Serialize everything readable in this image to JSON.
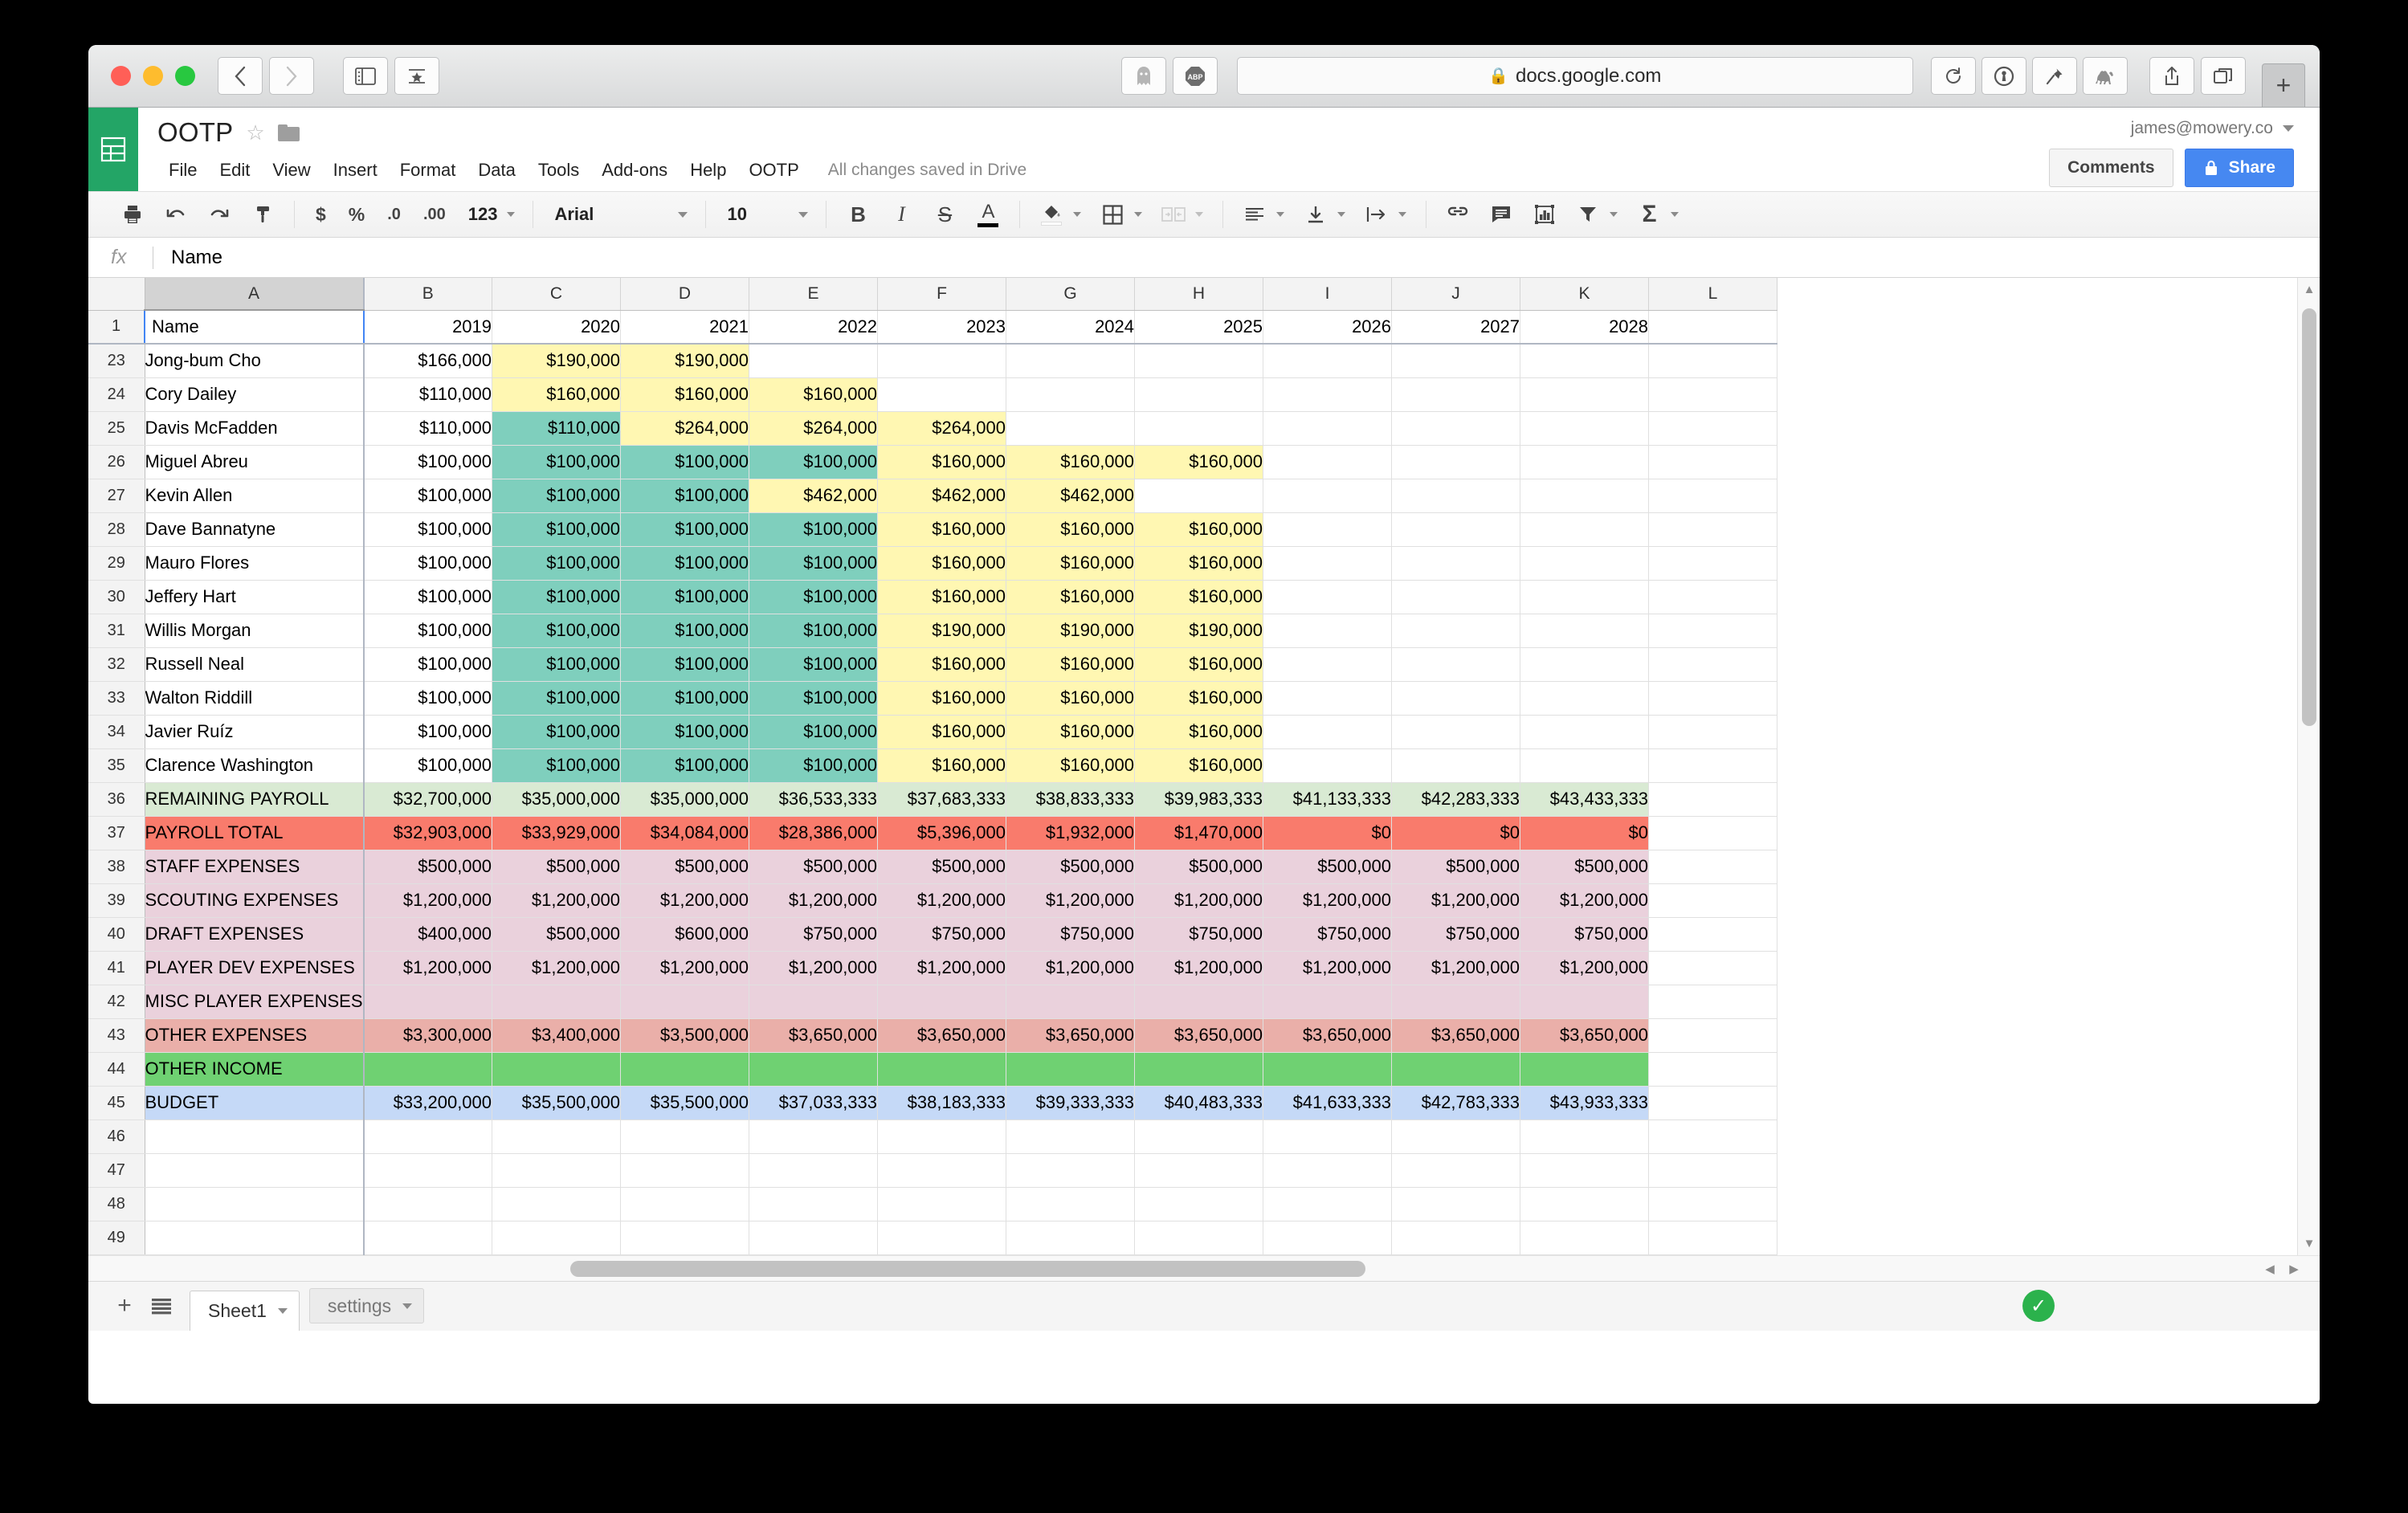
{
  "browser": {
    "url": "docs.google.com",
    "lock_icon": "lock-icon",
    "back_icon": "back-chevron-icon",
    "forward_icon": "forward-chevron-icon",
    "sidebar_icon": "sidebar-icon",
    "reader_icon": "reading-list-star-icon",
    "ghostery_icon": "ghostery-ghost-icon",
    "adblock_label": "ABP",
    "reload_icon": "reload-icon",
    "onepassword_icon": "1password-icon",
    "pinboard_icon": "pushpin-icon",
    "camel_icon": "camel-icon",
    "share_icon": "share-icon",
    "tabs_icon": "tab-overview-icon",
    "newtab_label": "+"
  },
  "app": {
    "logo_icon": "google-sheets-icon",
    "title": "OOTP",
    "star_icon": "star-outline-icon",
    "folder_icon": "folder-icon",
    "menus": [
      "File",
      "Edit",
      "View",
      "Insert",
      "Format",
      "Data",
      "Tools",
      "Add-ons",
      "Help",
      "OOTP"
    ],
    "save_status": "All changes saved in Drive",
    "account_email": "james@mowery.co",
    "comments_label": "Comments",
    "share_label": "Share",
    "share_lock_icon": "lock-icon"
  },
  "toolbar": {
    "print_icon": "print-icon",
    "undo_icon": "undo-icon",
    "redo_icon": "redo-icon",
    "paint_icon": "paint-format-icon",
    "currency_label": "$",
    "percent_label": "%",
    "dec_decrease_label": ".0",
    "dec_increase_label": ".00",
    "number_format_label": "123",
    "font_family": "Arial",
    "font_size": "10",
    "bold_label": "B",
    "italic_label": "I",
    "strikethrough_label": "S",
    "text_color_label": "A",
    "fill_icon": "fill-color-icon",
    "borders_icon": "borders-icon",
    "merge_icon": "merge-cells-icon",
    "align_icon": "horizontal-align-icon",
    "valign_icon": "vertical-align-icon",
    "wrap_icon": "text-wrap-icon",
    "link_icon": "insert-link-icon",
    "comment_icon": "insert-comment-icon",
    "chart_icon": "insert-chart-icon",
    "filter_icon": "filter-icon",
    "functions_icon": "sum-sigma-icon"
  },
  "formula_bar": {
    "fx_label": "fx",
    "value": "Name"
  },
  "grid": {
    "selected_cell": "A1",
    "columns": [
      "A",
      "B",
      "C",
      "D",
      "E",
      "F",
      "G",
      "H",
      "I",
      "J",
      "K",
      "L"
    ],
    "header_row_number": "1",
    "header_values": [
      "Name",
      "2019",
      "2020",
      "2021",
      "2022",
      "2023",
      "2024",
      "2025",
      "2026",
      "2027",
      "2028",
      ""
    ],
    "rows": [
      {
        "n": "23",
        "name": "Jong-bum Cho",
        "style": "player",
        "vals": [
          "$166,000",
          "$190,000",
          "$190,000",
          "",
          "",
          "",
          "",
          "",
          "",
          ""
        ],
        "fills": [
          "w",
          "y",
          "y",
          "w",
          "w",
          "w",
          "w",
          "w",
          "w",
          "w"
        ]
      },
      {
        "n": "24",
        "name": "Cory Dailey",
        "style": "player",
        "vals": [
          "$110,000",
          "$160,000",
          "$160,000",
          "$160,000",
          "",
          "",
          "",
          "",
          "",
          ""
        ],
        "fills": [
          "w",
          "y",
          "y",
          "y",
          "w",
          "w",
          "w",
          "w",
          "w",
          "w"
        ]
      },
      {
        "n": "25",
        "name": "Davis McFadden",
        "style": "player",
        "vals": [
          "$110,000",
          "$110,000",
          "$264,000",
          "$264,000",
          "$264,000",
          "",
          "",
          "",
          "",
          ""
        ],
        "fills": [
          "w",
          "t",
          "y",
          "y",
          "y",
          "w",
          "w",
          "w",
          "w",
          "w"
        ]
      },
      {
        "n": "26",
        "name": "Miguel Abreu",
        "style": "player",
        "vals": [
          "$100,000",
          "$100,000",
          "$100,000",
          "$100,000",
          "$160,000",
          "$160,000",
          "$160,000",
          "",
          "",
          ""
        ],
        "fills": [
          "w",
          "t",
          "t",
          "t",
          "y",
          "y",
          "y",
          "w",
          "w",
          "w"
        ]
      },
      {
        "n": "27",
        "name": "Kevin Allen",
        "style": "player",
        "vals": [
          "$100,000",
          "$100,000",
          "$100,000",
          "$462,000",
          "$462,000",
          "$462,000",
          "",
          "",
          "",
          ""
        ],
        "fills": [
          "w",
          "t",
          "t",
          "y",
          "y",
          "y",
          "w",
          "w",
          "w",
          "w"
        ]
      },
      {
        "n": "28",
        "name": "Dave Bannatyne",
        "style": "player",
        "vals": [
          "$100,000",
          "$100,000",
          "$100,000",
          "$100,000",
          "$160,000",
          "$160,000",
          "$160,000",
          "",
          "",
          ""
        ],
        "fills": [
          "w",
          "t",
          "t",
          "t",
          "y",
          "y",
          "y",
          "w",
          "w",
          "w"
        ]
      },
      {
        "n": "29",
        "name": "Mauro Flores",
        "style": "player",
        "vals": [
          "$100,000",
          "$100,000",
          "$100,000",
          "$100,000",
          "$160,000",
          "$160,000",
          "$160,000",
          "",
          "",
          ""
        ],
        "fills": [
          "w",
          "t",
          "t",
          "t",
          "y",
          "y",
          "y",
          "w",
          "w",
          "w"
        ]
      },
      {
        "n": "30",
        "name": "Jeffery Hart",
        "style": "player",
        "vals": [
          "$100,000",
          "$100,000",
          "$100,000",
          "$100,000",
          "$160,000",
          "$160,000",
          "$160,000",
          "",
          "",
          ""
        ],
        "fills": [
          "w",
          "t",
          "t",
          "t",
          "y",
          "y",
          "y",
          "w",
          "w",
          "w"
        ]
      },
      {
        "n": "31",
        "name": "Willis Morgan",
        "style": "player",
        "vals": [
          "$100,000",
          "$100,000",
          "$100,000",
          "$100,000",
          "$190,000",
          "$190,000",
          "$190,000",
          "",
          "",
          ""
        ],
        "fills": [
          "w",
          "t",
          "t",
          "t",
          "y",
          "y",
          "y",
          "w",
          "w",
          "w"
        ]
      },
      {
        "n": "32",
        "name": "Russell Neal",
        "style": "player",
        "vals": [
          "$100,000",
          "$100,000",
          "$100,000",
          "$100,000",
          "$160,000",
          "$160,000",
          "$160,000",
          "",
          "",
          ""
        ],
        "fills": [
          "w",
          "t",
          "t",
          "t",
          "y",
          "y",
          "y",
          "w",
          "w",
          "w"
        ]
      },
      {
        "n": "33",
        "name": "Walton Riddill",
        "style": "player",
        "vals": [
          "$100,000",
          "$100,000",
          "$100,000",
          "$100,000",
          "$160,000",
          "$160,000",
          "$160,000",
          "",
          "",
          ""
        ],
        "fills": [
          "w",
          "t",
          "t",
          "t",
          "y",
          "y",
          "y",
          "w",
          "w",
          "w"
        ]
      },
      {
        "n": "34",
        "name": "Javier Ruíz",
        "style": "player",
        "vals": [
          "$100,000",
          "$100,000",
          "$100,000",
          "$100,000",
          "$160,000",
          "$160,000",
          "$160,000",
          "",
          "",
          ""
        ],
        "fills": [
          "w",
          "t",
          "t",
          "t",
          "y",
          "y",
          "y",
          "w",
          "w",
          "w"
        ]
      },
      {
        "n": "35",
        "name": "Clarence Washington",
        "style": "player",
        "vals": [
          "$100,000",
          "$100,000",
          "$100,000",
          "$100,000",
          "$160,000",
          "$160,000",
          "$160,000",
          "",
          "",
          ""
        ],
        "fills": [
          "w",
          "t",
          "t",
          "t",
          "y",
          "y",
          "y",
          "w",
          "w",
          "w"
        ]
      },
      {
        "n": "36",
        "name": "REMAINING PAYROLL",
        "style": "lightgreen",
        "vals": [
          "$32,700,000",
          "$35,000,000",
          "$35,000,000",
          "$36,533,333",
          "$37,683,333",
          "$38,833,333",
          "$39,983,333",
          "$41,133,333",
          "$42,283,333",
          "$43,433,333"
        ],
        "fills": [
          "lg",
          "lg",
          "lg",
          "lg",
          "lg",
          "lg",
          "lg",
          "lg",
          "lg",
          "lg"
        ]
      },
      {
        "n": "37",
        "name": "PAYROLL TOTAL",
        "style": "red",
        "vals": [
          "$32,903,000",
          "$33,929,000",
          "$34,084,000",
          "$28,386,000",
          "$5,396,000",
          "$1,932,000",
          "$1,470,000",
          "$0",
          "$0",
          "$0"
        ],
        "fills": [
          "r",
          "r",
          "r",
          "r",
          "r",
          "r",
          "r",
          "r",
          "r",
          "r"
        ]
      },
      {
        "n": "38",
        "name": "STAFF EXPENSES",
        "style": "pink",
        "vals": [
          "$500,000",
          "$500,000",
          "$500,000",
          "$500,000",
          "$500,000",
          "$500,000",
          "$500,000",
          "$500,000",
          "$500,000",
          "$500,000"
        ],
        "fills": [
          "p",
          "p",
          "p",
          "p",
          "p",
          "p",
          "p",
          "p",
          "p",
          "p"
        ]
      },
      {
        "n": "39",
        "name": "SCOUTING EXPENSES",
        "style": "pink",
        "vals": [
          "$1,200,000",
          "$1,200,000",
          "$1,200,000",
          "$1,200,000",
          "$1,200,000",
          "$1,200,000",
          "$1,200,000",
          "$1,200,000",
          "$1,200,000",
          "$1,200,000"
        ],
        "fills": [
          "p",
          "p",
          "p",
          "p",
          "p",
          "p",
          "p",
          "p",
          "p",
          "p"
        ]
      },
      {
        "n": "40",
        "name": "DRAFT EXPENSES",
        "style": "pink",
        "vals": [
          "$400,000",
          "$500,000",
          "$600,000",
          "$750,000",
          "$750,000",
          "$750,000",
          "$750,000",
          "$750,000",
          "$750,000",
          "$750,000"
        ],
        "fills": [
          "p",
          "p",
          "p",
          "p",
          "p",
          "p",
          "p",
          "p",
          "p",
          "p"
        ]
      },
      {
        "n": "41",
        "name": "PLAYER DEV EXPENSES",
        "style": "pink",
        "vals": [
          "$1,200,000",
          "$1,200,000",
          "$1,200,000",
          "$1,200,000",
          "$1,200,000",
          "$1,200,000",
          "$1,200,000",
          "$1,200,000",
          "$1,200,000",
          "$1,200,000"
        ],
        "fills": [
          "p",
          "p",
          "p",
          "p",
          "p",
          "p",
          "p",
          "p",
          "p",
          "p"
        ]
      },
      {
        "n": "42",
        "name": "MISC PLAYER EXPENSES",
        "style": "pink",
        "vals": [
          "",
          "",
          "",
          "",
          "",
          "",
          "",
          "",
          "",
          ""
        ],
        "fills": [
          "p",
          "p",
          "p",
          "p",
          "p",
          "p",
          "p",
          "p",
          "p",
          "p"
        ]
      },
      {
        "n": "43",
        "name": "OTHER EXPENSES",
        "style": "darkpink",
        "vals": [
          "$3,300,000",
          "$3,400,000",
          "$3,500,000",
          "$3,650,000",
          "$3,650,000",
          "$3,650,000",
          "$3,650,000",
          "$3,650,000",
          "$3,650,000",
          "$3,650,000"
        ],
        "fills": [
          "dp",
          "dp",
          "dp",
          "dp",
          "dp",
          "dp",
          "dp",
          "dp",
          "dp",
          "dp"
        ]
      },
      {
        "n": "44",
        "name": "OTHER INCOME",
        "style": "green",
        "vals": [
          "",
          "",
          "",
          "",
          "",
          "",
          "",
          "",
          "",
          ""
        ],
        "fills": [
          "g",
          "g",
          "g",
          "g",
          "g",
          "g",
          "g",
          "g",
          "g",
          "g"
        ]
      },
      {
        "n": "45",
        "name": "BUDGET",
        "style": "blue",
        "vals": [
          "$33,200,000",
          "$35,500,000",
          "$35,500,000",
          "$37,033,333",
          "$38,183,333",
          "$39,333,333",
          "$40,483,333",
          "$41,633,333",
          "$42,783,333",
          "$43,933,333"
        ],
        "fills": [
          "b",
          "b",
          "b",
          "b",
          "b",
          "b",
          "b",
          "b",
          "b",
          "b"
        ]
      },
      {
        "n": "46",
        "name": "",
        "style": "empty",
        "vals": [
          "",
          "",
          "",
          "",
          "",
          "",
          "",
          "",
          "",
          ""
        ],
        "fills": [
          "w",
          "w",
          "w",
          "w",
          "w",
          "w",
          "w",
          "w",
          "w",
          "w"
        ]
      },
      {
        "n": "47",
        "name": "",
        "style": "empty",
        "vals": [
          "",
          "",
          "",
          "",
          "",
          "",
          "",
          "",
          "",
          ""
        ],
        "fills": [
          "w",
          "w",
          "w",
          "w",
          "w",
          "w",
          "w",
          "w",
          "w",
          "w"
        ]
      },
      {
        "n": "48",
        "name": "",
        "style": "empty",
        "vals": [
          "",
          "",
          "",
          "",
          "",
          "",
          "",
          "",
          "",
          ""
        ],
        "fills": [
          "w",
          "w",
          "w",
          "w",
          "w",
          "w",
          "w",
          "w",
          "w",
          "w"
        ]
      },
      {
        "n": "49",
        "name": "",
        "style": "empty",
        "vals": [
          "",
          "",
          "",
          "",
          "",
          "",
          "",
          "",
          "",
          ""
        ],
        "fills": [
          "w",
          "w",
          "w",
          "w",
          "w",
          "w",
          "w",
          "w",
          "w",
          "w"
        ]
      }
    ]
  },
  "bottom": {
    "add_sheet_icon": "add-sheet-plus-icon",
    "all_sheets_icon": "all-sheets-list-icon",
    "tabs": [
      {
        "label": "Sheet1",
        "active": true
      },
      {
        "label": "settings",
        "active": false
      }
    ],
    "saved_icon": "saved-check-icon"
  },
  "colors": {
    "brand_green": "#23a566",
    "share_blue": "#4688f1",
    "fill_yellow": "#fff7b2",
    "fill_teal": "#7fcfbd",
    "fill_lightgreen": "#d9ead3",
    "fill_red": "#f97b6c",
    "fill_pink": "#ead1dc",
    "fill_darkpink": "#eaafa9",
    "fill_green": "#6fd172",
    "fill_blue": "#c5d9f7",
    "selection_blue": "#4285f4"
  }
}
